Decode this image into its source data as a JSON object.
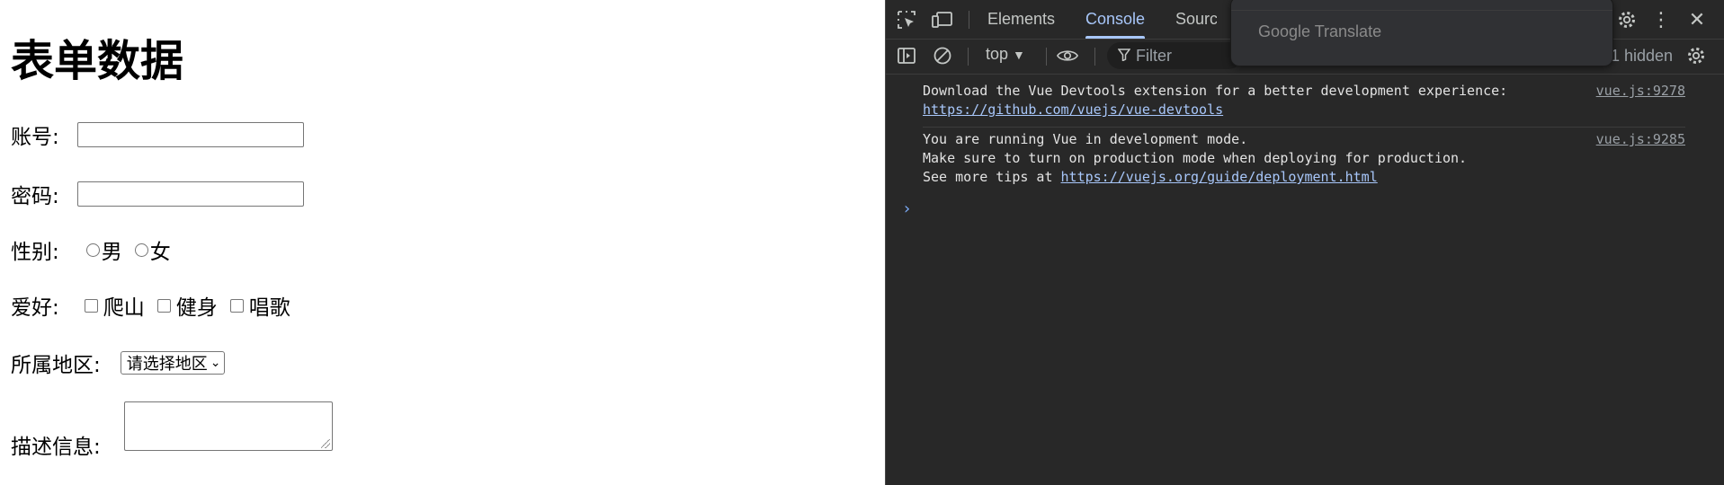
{
  "form": {
    "title": "表单数据",
    "account_label": "账号:",
    "account_value": "",
    "password_label": "密码:",
    "password_value": "",
    "gender_label": "性别:",
    "gender_options": [
      "男",
      "女"
    ],
    "hobby_label": "爱好:",
    "hobby_options": [
      "爬山",
      "健身",
      "唱歌"
    ],
    "region_label": "所属地区:",
    "region_selected": "请选择地区",
    "desc_label": "描述信息:",
    "desc_value": ""
  },
  "devtools": {
    "tabs": [
      "Elements",
      "Console",
      "Sources"
    ],
    "active_tab": "Console",
    "context": "top",
    "filter_placeholder": "Filter",
    "hidden_count": "1 hidden",
    "messages": [
      {
        "lines": [
          "Download the Vue Devtools extension for a better development experience:"
        ],
        "link": "https://github.com/vuejs/vue-devtools",
        "source": "vue.js:9278"
      },
      {
        "lines": [
          "You are running Vue in development mode.",
          "Make sure to turn on production mode when deploying for production.",
          "See more tips at "
        ],
        "link": "https://vuejs.org/guide/deployment.html",
        "source": "vue.js:9285"
      }
    ],
    "prompt_symbol": "›"
  },
  "translate_popup": {
    "label": "Google Translate"
  },
  "icons": [
    "inspect-icon",
    "device-toolbar-icon",
    "settings-icon",
    "more-icon",
    "close-icon",
    "sidebar-icon",
    "clear-console-icon",
    "eye-icon",
    "filter-icon"
  ],
  "colors": {
    "devtools_bg": "#282828",
    "active_tab": "#a8c7fa",
    "link": "#a8c7fa",
    "text": "#e3e3e3"
  }
}
